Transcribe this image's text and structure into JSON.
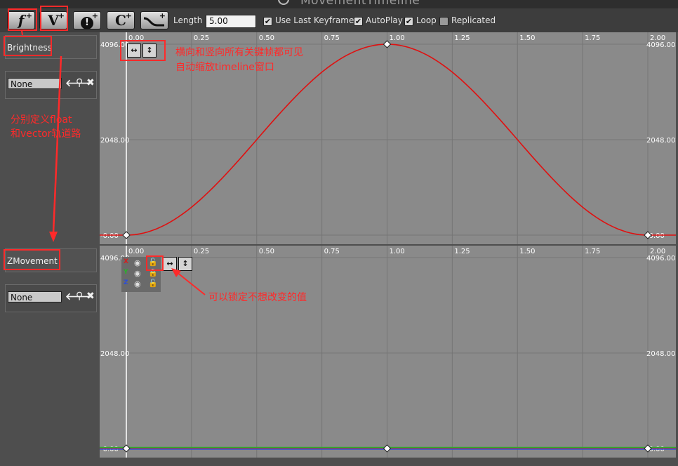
{
  "window": {
    "title": "MovementTimeline"
  },
  "toolbar": {
    "add_float_track": "f",
    "add_vector_track": "V",
    "add_event_track": "!",
    "add_color_track": "C",
    "length_label": "Length",
    "length_value": "5.00",
    "use_last_keyframe_label": "Use Last Keyframe?",
    "use_last_keyframe_checked": true,
    "autoplay_label": "AutoPlay",
    "autoplay_checked": true,
    "loop_label": "Loop",
    "loop_checked": true,
    "replicated_label": "Replicated",
    "replicated_checked": false
  },
  "tracks": [
    {
      "name": "Brightness",
      "curve_asset": "None"
    },
    {
      "name": "ZMovement",
      "curve_asset": "None"
    }
  ],
  "time_ticks": [
    "0.00",
    "0.25",
    "0.50",
    "0.75",
    "1.00",
    "1.25",
    "1.50",
    "1.75",
    "2.00"
  ],
  "value_ticks": [
    "4096.00",
    "2048.00",
    "-0.00"
  ],
  "vector_channels": [
    "X",
    "Y",
    "Z"
  ],
  "annotations": {
    "zoom_note_line1": "横向和竖向所有关键帧都可见",
    "zoom_note_line2": "自动缩放timeline窗口",
    "track_type_note_line1": "分别定义float",
    "track_type_note_line2": "和vector轨道路",
    "lock_note": "可以锁定不想改变的值"
  },
  "colors": {
    "curve_float": "#e01010",
    "channel_x": "#d32020",
    "channel_y": "#2ab02a",
    "channel_z": "#2c4ed8",
    "annotation": "#ff2a2a"
  },
  "chart_data": [
    {
      "type": "line",
      "series": [
        {
          "name": "Brightness",
          "x": [
            0.0,
            1.0,
            2.0
          ],
          "y": [
            0,
            4096,
            0
          ]
        }
      ],
      "xlim": [
        0,
        2
      ],
      "ylim": [
        0,
        4096
      ]
    },
    {
      "type": "line",
      "series": [
        {
          "name": "X",
          "x": [
            0.0,
            1.0,
            2.0
          ],
          "y": [
            0,
            0,
            0
          ]
        },
        {
          "name": "Y",
          "x": [
            0.0,
            1.0,
            2.0
          ],
          "y": [
            0,
            0,
            0
          ]
        },
        {
          "name": "Z",
          "x": [
            0.0,
            1.0,
            2.0
          ],
          "y": [
            0,
            0,
            0
          ]
        }
      ],
      "xlim": [
        0,
        2
      ],
      "ylim": [
        0,
        4096
      ]
    }
  ]
}
